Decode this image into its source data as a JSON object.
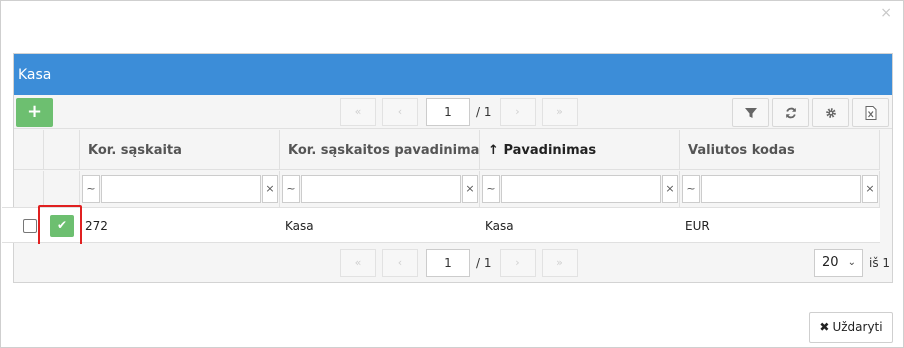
{
  "dialog": {
    "close_glyph": "×"
  },
  "grid": {
    "title": "Kasa",
    "toolbar": {
      "add_glyph": "+",
      "pager": {
        "first": "«",
        "prev": "‹",
        "page": "1",
        "total": "/ 1",
        "next": "›",
        "last": "»"
      },
      "icons": [
        "filter-icon",
        "refresh-icon",
        "gear-icon",
        "excel-export-icon"
      ]
    },
    "columns": [
      {
        "label": "Kor. sąskaita",
        "sorted": false
      },
      {
        "label": "Kor. sąskaitos pavadinimas",
        "sorted": false
      },
      {
        "label": "Pavadinimas",
        "sorted": true,
        "sort_glyph": "↑"
      },
      {
        "label": "Valiutos kodas",
        "sorted": false
      }
    ],
    "filter": {
      "op_glyph": "~",
      "clear_glyph": "×"
    },
    "rows": [
      {
        "select_glyph": "✔",
        "cells": [
          "272",
          "Kasa",
          "Kasa",
          "EUR"
        ]
      }
    ],
    "footer": {
      "pager": {
        "first": "«",
        "prev": "‹",
        "page": "1",
        "total": "/ 1",
        "next": "›",
        "last": "»"
      },
      "page_size": "20",
      "page_size_caret": "⌄",
      "of_total": "iš 1"
    }
  },
  "actions": {
    "close_glyph": "✖",
    "close_label": "Uždaryti"
  },
  "colors": {
    "header_blue": "#3c8dd8",
    "accent_green": "#6dbf70",
    "highlight_red": "#e02020"
  }
}
